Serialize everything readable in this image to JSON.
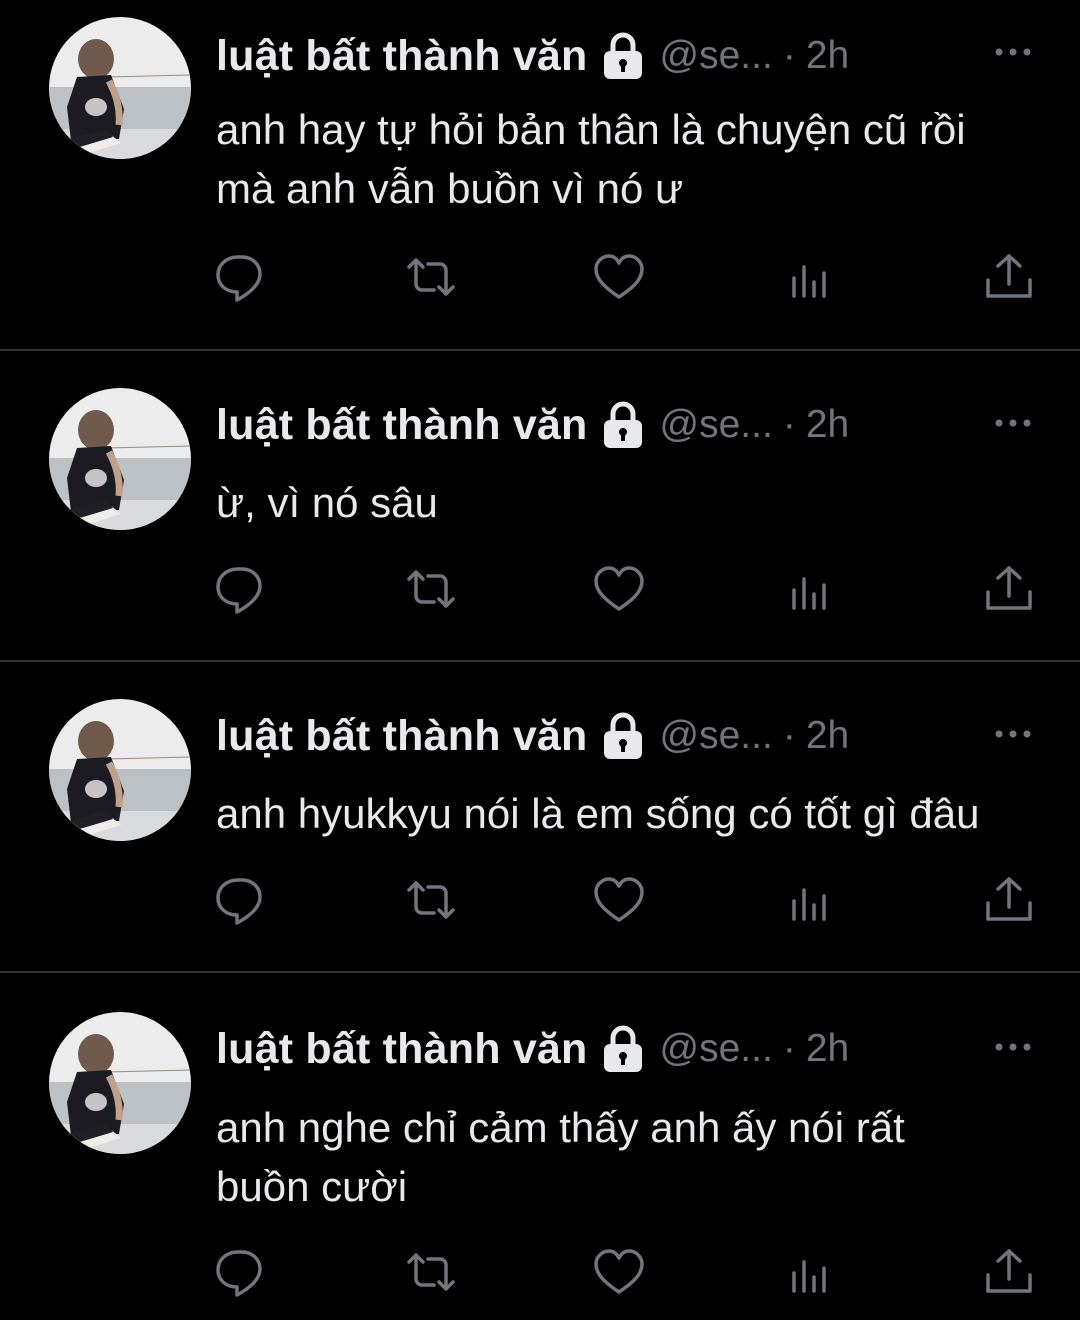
{
  "colors": {
    "background": "#000000",
    "text_primary": "#e7e9ea",
    "text_secondary": "#71767b",
    "divider": "#2f3336"
  },
  "tweets": [
    {
      "display_name": "luật bất thành văn",
      "protected_icon": "lock-icon",
      "handle": "@se...",
      "separator": "·",
      "time": "2h",
      "text": "anh hay tự hỏi bản thân là chuyện cũ rồi\nmà anh vẫn buồn vì nó ư",
      "actions": [
        "reply-icon",
        "retweet-icon",
        "like-icon",
        "views-icon",
        "share-icon"
      ]
    },
    {
      "display_name": "luật bất thành văn",
      "protected_icon": "lock-icon",
      "handle": "@se...",
      "separator": "·",
      "time": "2h",
      "text": "ừ, vì nó sâu",
      "actions": [
        "reply-icon",
        "retweet-icon",
        "like-icon",
        "views-icon",
        "share-icon"
      ]
    },
    {
      "display_name": "luật bất thành văn",
      "protected_icon": "lock-icon",
      "handle": "@se...",
      "separator": "·",
      "time": "2h",
      "text": "anh hyukkyu nói là em sống có tốt gì đâu",
      "actions": [
        "reply-icon",
        "retweet-icon",
        "like-icon",
        "views-icon",
        "share-icon"
      ]
    },
    {
      "display_name": "luật bất thành văn",
      "protected_icon": "lock-icon",
      "handle": "@se...",
      "separator": "·",
      "time": "2h",
      "text": "anh nghe chỉ cảm thấy anh ấy nói rất\nbuồn cười",
      "actions": [
        "reply-icon",
        "retweet-icon",
        "like-icon",
        "views-icon",
        "share-icon"
      ]
    }
  ]
}
